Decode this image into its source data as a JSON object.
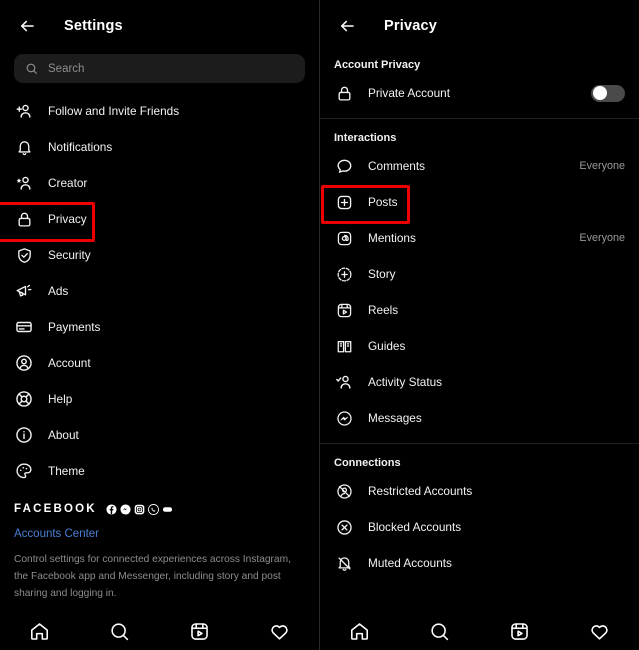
{
  "left": {
    "header": {
      "title": "Settings",
      "back_icon": "arrow-left-icon"
    },
    "search": {
      "placeholder": "Search",
      "icon": "search-icon"
    },
    "items": [
      {
        "label": "Follow and Invite Friends",
        "icon": "person-add-icon",
        "highlight": false
      },
      {
        "label": "Notifications",
        "icon": "bell-icon",
        "highlight": false
      },
      {
        "label": "Creator",
        "icon": "person-star-icon",
        "highlight": false
      },
      {
        "label": "Privacy",
        "icon": "lock-icon",
        "highlight": true
      },
      {
        "label": "Security",
        "icon": "shield-check-icon",
        "highlight": false
      },
      {
        "label": "Ads",
        "icon": "megaphone-icon",
        "highlight": false
      },
      {
        "label": "Payments",
        "icon": "credit-card-icon",
        "highlight": false
      },
      {
        "label": "Account",
        "icon": "person-circle-icon",
        "highlight": false
      },
      {
        "label": "Help",
        "icon": "lifebuoy-icon",
        "highlight": false
      },
      {
        "label": "About",
        "icon": "info-circle-icon",
        "highlight": false
      },
      {
        "label": "Theme",
        "icon": "palette-icon",
        "highlight": false
      }
    ],
    "facebook": {
      "wordmark": "FACEBOOK",
      "icons": [
        "facebook-icon",
        "messenger-icon",
        "instagram-icon",
        "whatsapp-icon",
        "portal-icon"
      ],
      "link": "Accounts Center",
      "description": "Control settings for connected experiences across Instagram, the Facebook app and Messenger, including story and post sharing and logging in."
    },
    "bottom_nav": [
      {
        "icon": "home-icon"
      },
      {
        "icon": "search-icon"
      },
      {
        "icon": "reels-icon"
      },
      {
        "icon": "heart-icon"
      }
    ]
  },
  "right": {
    "header": {
      "title": "Privacy",
      "back_icon": "arrow-left-icon"
    },
    "sections": [
      {
        "title": "Account Privacy",
        "items": [
          {
            "label": "Private Account",
            "icon": "lock-icon",
            "toggle": true,
            "toggle_on": false,
            "highlight": false
          }
        ]
      },
      {
        "title": "Interactions",
        "items": [
          {
            "label": "Comments",
            "icon": "comment-icon",
            "value": "Everyone",
            "highlight": false
          },
          {
            "label": "Posts",
            "icon": "plus-square-icon",
            "highlight": true
          },
          {
            "label": "Mentions",
            "icon": "at-sign-icon",
            "value": "Everyone",
            "highlight": false
          },
          {
            "label": "Story",
            "icon": "story-icon",
            "highlight": false
          },
          {
            "label": "Reels",
            "icon": "reels-icon",
            "highlight": false
          },
          {
            "label": "Guides",
            "icon": "guides-icon",
            "highlight": false
          },
          {
            "label": "Activity Status",
            "icon": "activity-status-icon",
            "highlight": false
          },
          {
            "label": "Messages",
            "icon": "messenger-icon",
            "highlight": false
          }
        ]
      },
      {
        "title": "Connections",
        "items": [
          {
            "label": "Restricted Accounts",
            "icon": "restricted-icon",
            "highlight": false
          },
          {
            "label": "Blocked Accounts",
            "icon": "blocked-icon",
            "highlight": false
          },
          {
            "label": "Muted Accounts",
            "icon": "muted-icon",
            "highlight": false
          }
        ]
      }
    ],
    "bottom_nav": [
      {
        "icon": "home-icon"
      },
      {
        "icon": "search-icon"
      },
      {
        "icon": "reels-icon"
      },
      {
        "icon": "heart-icon"
      }
    ]
  },
  "colors": {
    "background": "#000000",
    "highlight": "#ef0000",
    "link": "#4a7fd4",
    "muted_text": "#8d8d8d",
    "search_bg": "#1c1c1d"
  }
}
